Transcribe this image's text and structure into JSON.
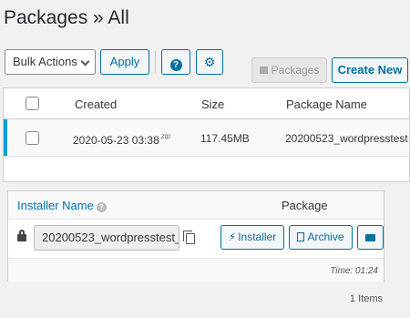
{
  "page": {
    "title": "Packages » All"
  },
  "toolbar": {
    "bulk_actions_label": "Bulk Actions",
    "apply_label": "Apply",
    "help_icon": "question-circle-icon",
    "settings_icon": "gear-icon"
  },
  "tabs": {
    "packages_label": "Packages",
    "create_new_label": "Create New"
  },
  "table": {
    "columns": {
      "created": "Created",
      "size": "Size",
      "name": "Package Name"
    },
    "rows": [
      {
        "created": "2020-05-23 03:38",
        "type_tag": "zip",
        "size": "117.45MB",
        "name": "20200523_wordpresstest"
      }
    ]
  },
  "details": {
    "installer_name_label": "Installer Name",
    "package_label": "Package",
    "installer_value": "20200523_wordpresstest_",
    "installer_button": "Installer",
    "archive_button": "Archive",
    "time_text": "Time: 01:24"
  },
  "footer": {
    "items_count": "1 Items"
  },
  "colors": {
    "accent": "#0071a1",
    "row_highlight": "#00a0d2",
    "background": "#f1f1f1"
  }
}
